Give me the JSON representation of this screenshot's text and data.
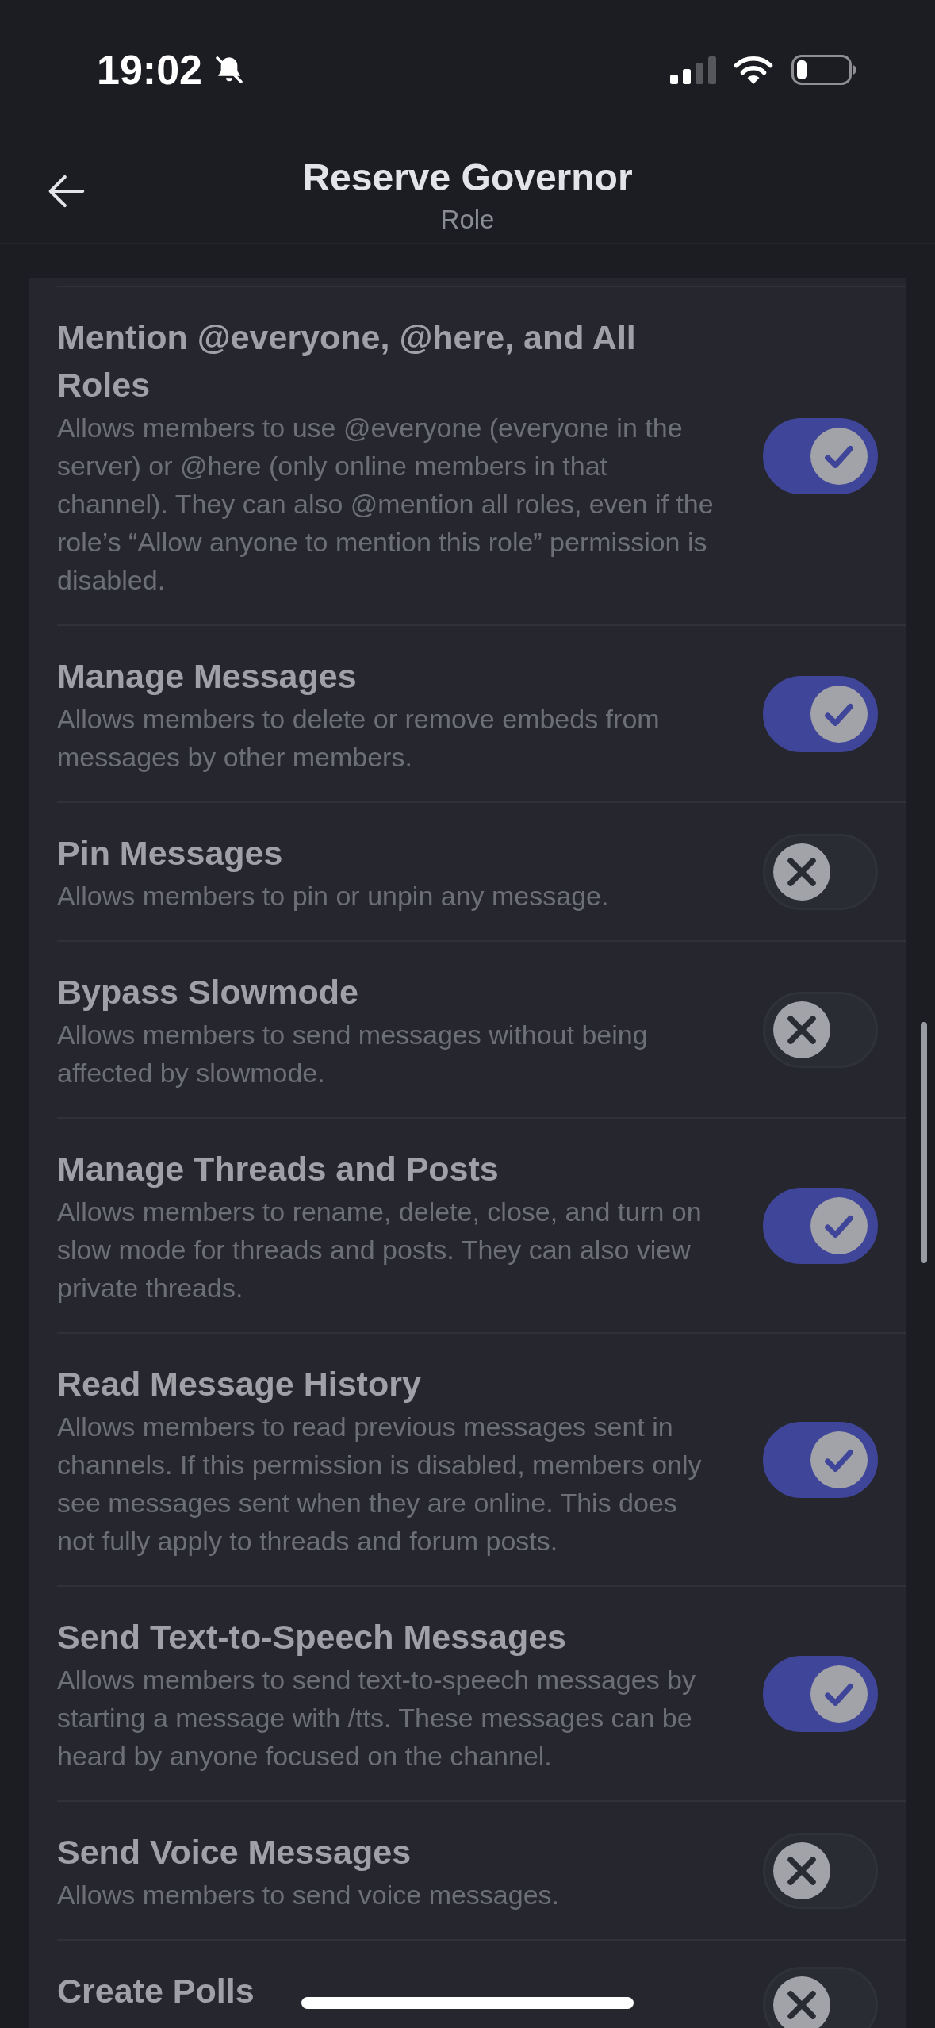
{
  "status_bar": {
    "time": "19:02"
  },
  "header": {
    "title": "Reserve Governor",
    "subtitle": "Role"
  },
  "permissions": [
    {
      "title": "Mention @everyone, @here, and All Roles",
      "description": "Allows members to use @everyone (everyone in the server) or @here (only online members in that channel). They can also @mention all roles, even if the role’s “Allow anyone to mention this role” permission is disabled.",
      "on": true
    },
    {
      "title": "Manage Messages",
      "description": "Allows members to delete or remove embeds from messages by other members.",
      "on": true
    },
    {
      "title": "Pin Messages",
      "description": "Allows members to pin or unpin any message.",
      "on": false
    },
    {
      "title": "Bypass Slowmode",
      "description": "Allows members to send messages without being affected by slowmode.",
      "on": false
    },
    {
      "title": "Manage Threads and Posts",
      "description": "Allows members to rename, delete, close, and turn on slow mode for threads and posts. They can also view private threads.",
      "on": true
    },
    {
      "title": "Read Message History",
      "description": "Allows members to read previous messages sent in channels. If this permission is disabled, members only see messages sent when they are online. This does not fully apply to threads and forum posts.",
      "on": true
    },
    {
      "title": "Send Text-to-Speech Messages",
      "description": "Allows members to send text-to-speech messages by starting a message with /tts. These messages can be heard by anyone focused on the channel.",
      "on": true
    },
    {
      "title": "Send Voice Messages",
      "description": "Allows members to send voice messages.",
      "on": false
    },
    {
      "title": "Create Polls",
      "on": false
    }
  ]
}
